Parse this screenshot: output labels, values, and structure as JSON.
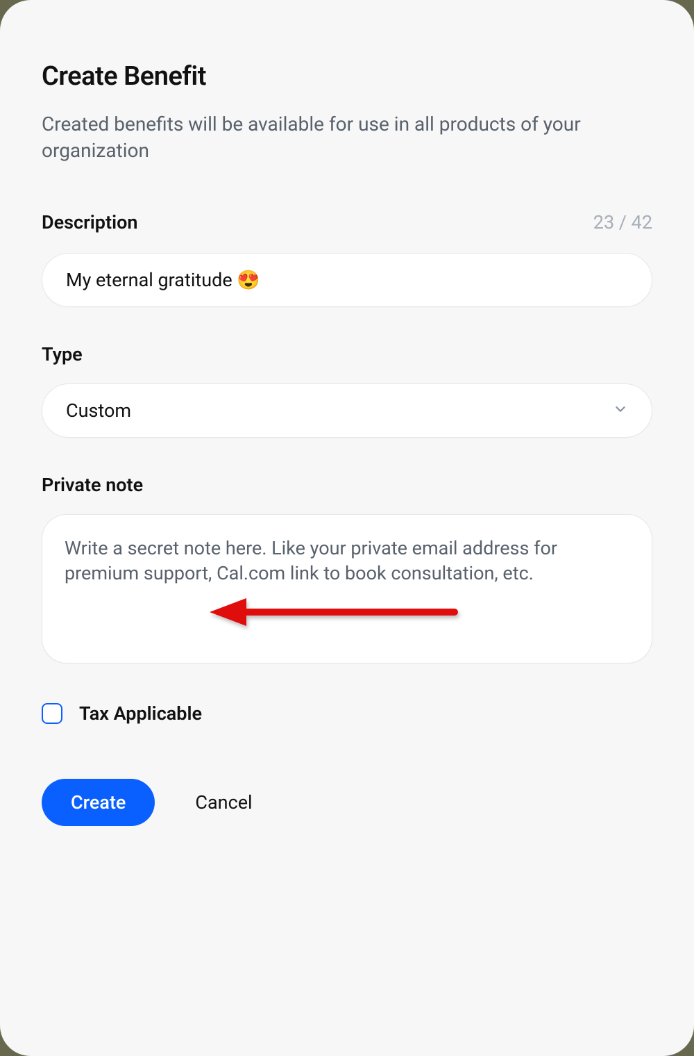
{
  "modal": {
    "title": "Create Benefit",
    "subtitle": "Created benefits will be available for use in all products of your organization"
  },
  "description": {
    "label": "Description",
    "value": "My eternal gratitude 😍",
    "counter": "23 / 42"
  },
  "type": {
    "label": "Type",
    "selected": "Custom"
  },
  "private_note": {
    "label": "Private note",
    "placeholder": "Write a secret note here. Like your private email address for premium support, Cal.com link to book consultation, etc.",
    "value": ""
  },
  "tax": {
    "label": "Tax Applicable",
    "checked": false
  },
  "buttons": {
    "create": "Create",
    "cancel": "Cancel"
  },
  "colors": {
    "accent": "#0a60ff",
    "annotation": "#e00707"
  }
}
